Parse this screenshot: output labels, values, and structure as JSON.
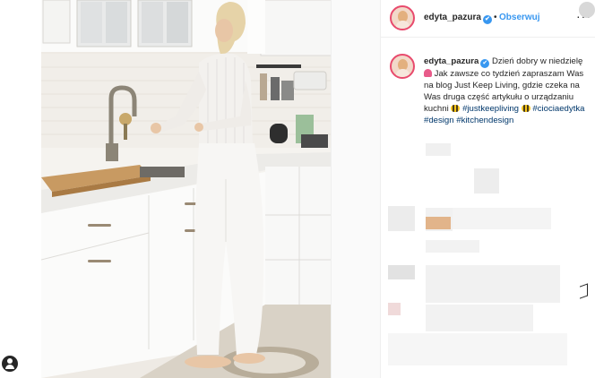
{
  "post": {
    "username": "edyta_pazura",
    "verified_badge": "✔",
    "dot": "•",
    "follow_label": "Obserwuj",
    "more_icon": "more-icon",
    "more_label": "···"
  },
  "caption": {
    "username": "edyta_pazura",
    "text_1": "Dzień dobry w niedzielę",
    "text_2": "Jak zawsze co tydzień zapraszam Was na blog Just Keep Living, gdzie czeka na Was druga część artykułu o urządzaniu kuchni",
    "hashtags": [
      "#justkeepliving",
      "#ciociaedytka",
      "#design",
      "#kitchendesign"
    ]
  },
  "colors": {
    "accent": "#3897f0",
    "story_ring": "#e84a6d",
    "hashtag": "#00376b"
  }
}
